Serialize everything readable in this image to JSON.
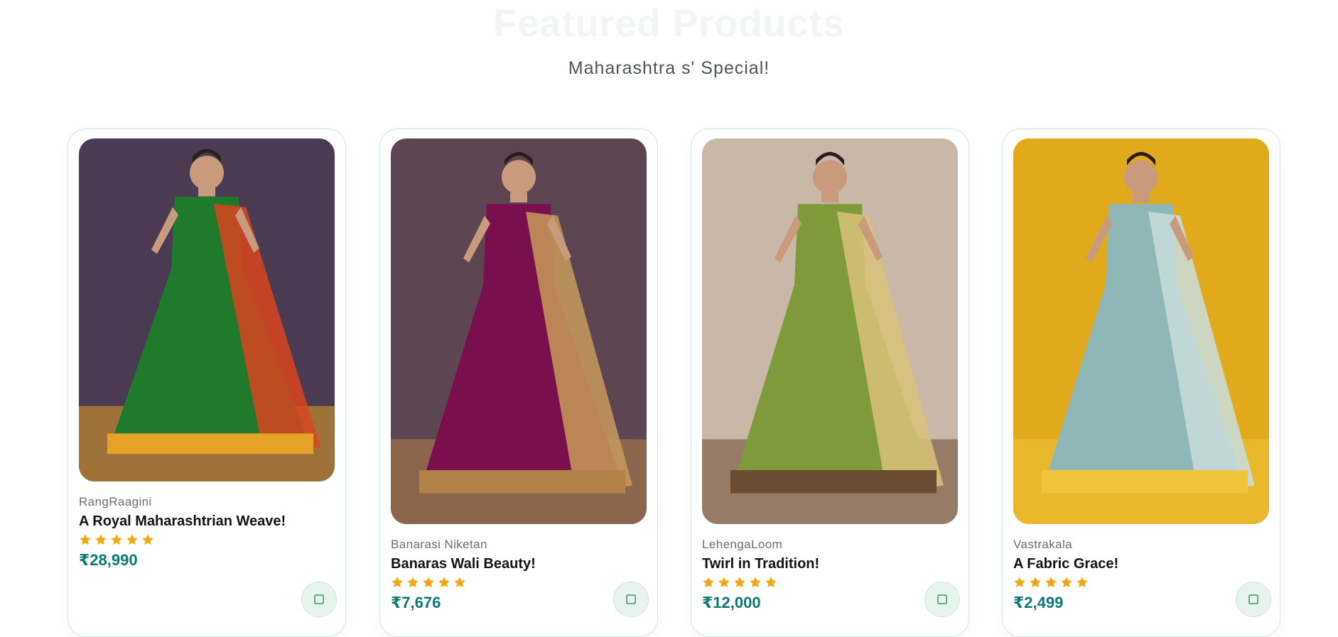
{
  "section": {
    "title": "Featured Products",
    "subtitle": "Maharashtra s' Special!"
  },
  "products": [
    {
      "brand": "RangRaagini",
      "name": "A Royal Maharashtrian Weave!",
      "rating": 5,
      "price": "₹28,990",
      "cart_icon": "cart-icon",
      "image": {
        "bg": "#4a3a52",
        "garment": "#1f7a2c",
        "accent": "#d9451f",
        "border": "#e6a127"
      }
    },
    {
      "brand": "Banarasi Niketan",
      "name": "Banaras Wali Beauty!",
      "rating": 5,
      "price": "₹7,676",
      "cart_icon": "cart-icon",
      "image": {
        "bg": "#5e4552",
        "garment": "#7a0f4d",
        "accent": "#c79a5a",
        "border": "#b08248"
      }
    },
    {
      "brand": "LehengaLoom",
      "name": "Twirl in Tradition!",
      "rating": 5,
      "price": "₹12,000",
      "cart_icon": "cart-icon",
      "image": {
        "bg": "#c9b8a8",
        "garment": "#7f9a3a",
        "accent": "#d8c27a",
        "border": "#6b4b32"
      }
    },
    {
      "brand": "Vastrakala",
      "name": "A Fabric Grace!",
      "rating": 5,
      "price": "₹2,499",
      "cart_icon": "cart-icon",
      "image": {
        "bg": "#e1a91c",
        "garment": "#8fb7b7",
        "accent": "#c8dedd",
        "border": "#f0c53a"
      }
    }
  ],
  "colors": {
    "price": "#0b7a74",
    "star": "#f2a90f",
    "card_border": "#cfe6df",
    "cart_bg": "#e7f4ee"
  }
}
